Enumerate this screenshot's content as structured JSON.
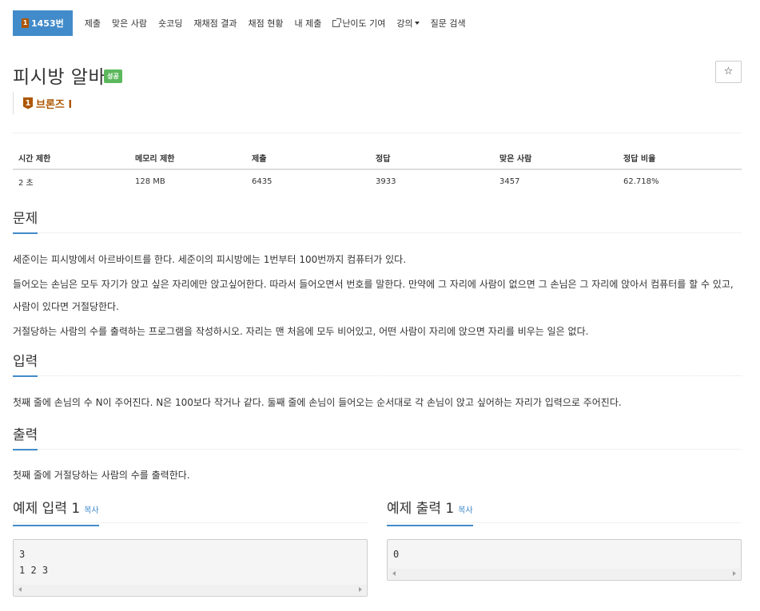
{
  "nav": {
    "problem_number": "1453번",
    "tier_badge_text": "1",
    "items": [
      "제출",
      "맞은 사람",
      "숏코딩",
      "재채점 결과",
      "채점 현황",
      "내 제출",
      "난이도 기여",
      "강의",
      "질문 검색"
    ]
  },
  "problem": {
    "title": "피시방 알바",
    "status": "성공",
    "star_icon": "☆",
    "tier_number": "1",
    "tier_label": "브론즈 I"
  },
  "info": {
    "headers": [
      "시간 제한",
      "메모리 제한",
      "제출",
      "정답",
      "맞은 사람",
      "정답 비율"
    ],
    "values": [
      "2 초",
      "128 MB",
      "6435",
      "3933",
      "3457",
      "62.718%"
    ]
  },
  "sections": {
    "description_title": "문제",
    "description": [
      "세준이는 피시방에서 아르바이트를 한다. 세준이의 피시방에는 1번부터 100번까지 컴퓨터가 있다.",
      "들어오는 손님은 모두 자기가 앉고 싶은 자리에만 앉고싶어한다. 따라서 들어오면서 번호를 말한다. 만약에 그 자리에 사람이 없으면 그 손님은 그 자리에 앉아서 컴퓨터를 할 수 있고, 사람이 있다면 거절당한다.",
      "거절당하는 사람의 수를 출력하는 프로그램을 작성하시오. 자리는 맨 처음에 모두 비어있고, 어떤 사람이 자리에 앉으면 자리를 비우는 일은 없다."
    ],
    "input_title": "입력",
    "input_text": "첫째 줄에 손님의 수 N이 주어진다. N은 100보다 작거나 같다. 둘째 줄에 손님이 들어오는 순서대로 각 손님이 앉고 싶어하는 자리가 입력으로 주어진다.",
    "output_title": "출력",
    "output_text": "첫째 줄에 거절당하는 사람의 수를 출력한다."
  },
  "samples": {
    "input_title": "예제 입력 1",
    "output_title": "예제 출력 1",
    "copy_label": "복사",
    "input_data": "3\n1 2 3",
    "output_data": "0"
  },
  "colors": {
    "primary": "#428bca",
    "success": "#5cb85c",
    "bronze": "#ad5600"
  }
}
